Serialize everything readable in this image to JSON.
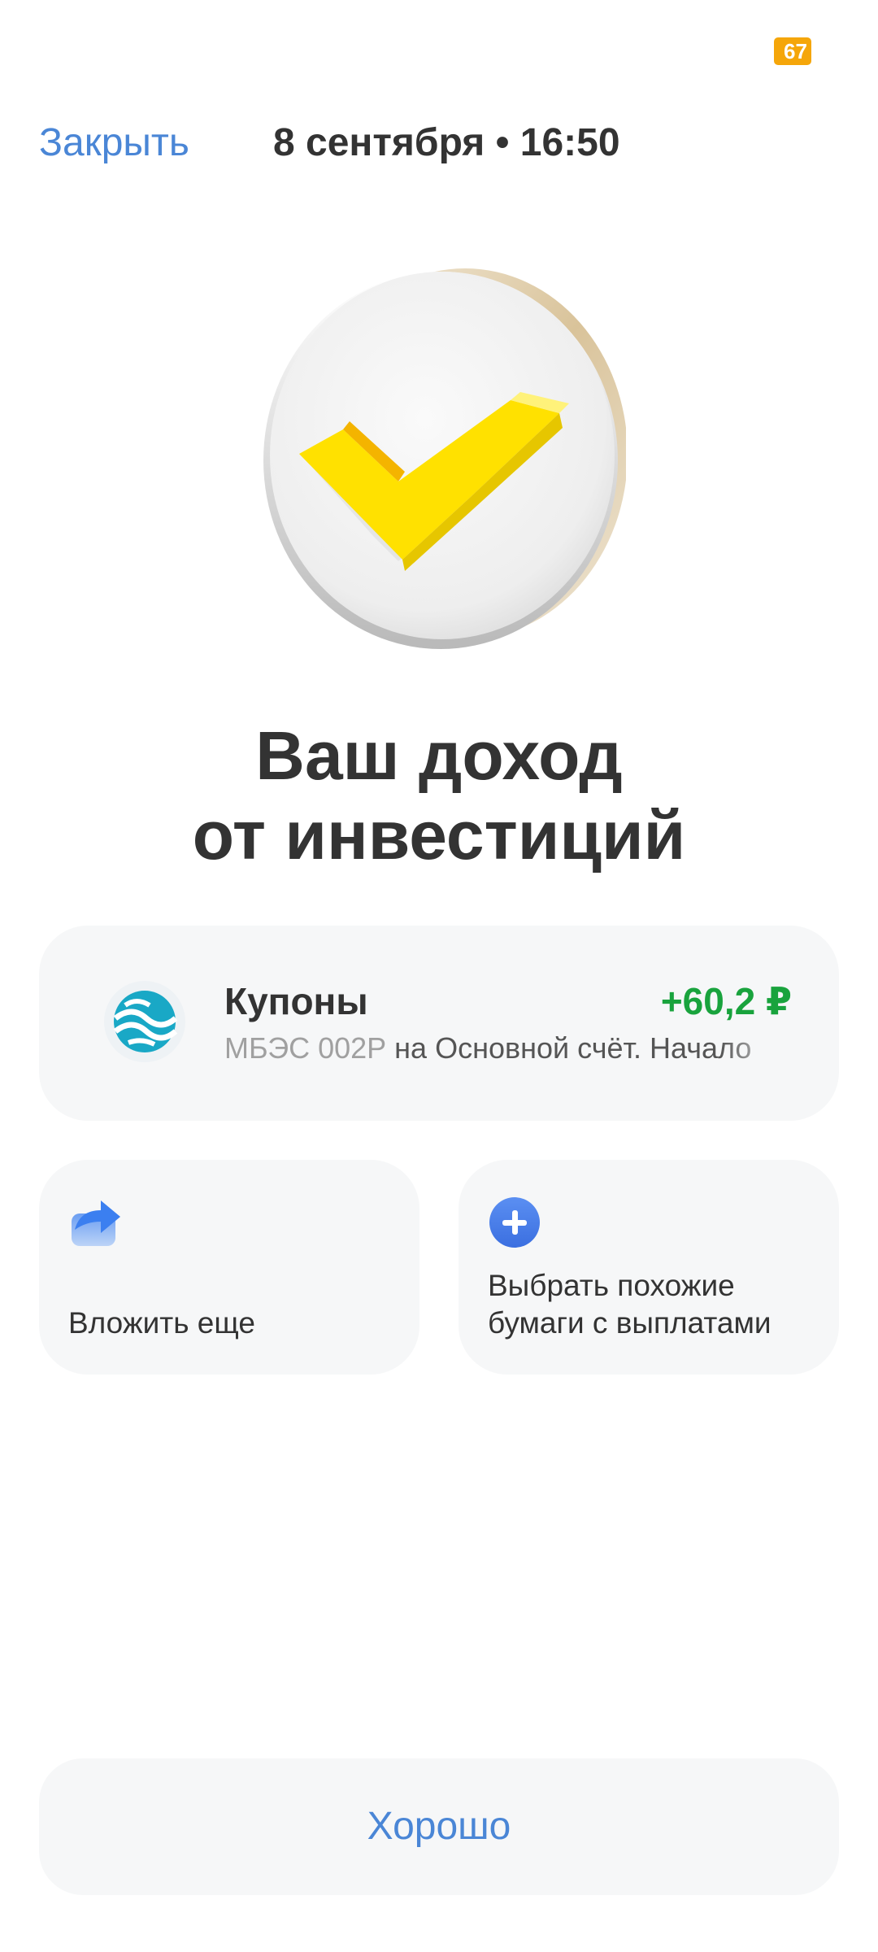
{
  "status_bar": {
    "battery_level": "67"
  },
  "header": {
    "close_label": "Закрыть",
    "date_time": "8 сентября • 16:50"
  },
  "hero": {
    "icon": "checkmark-coin-icon",
    "title_line1": "Ваш доход",
    "title_line2": "от инвестиций"
  },
  "coupon": {
    "issuer_icon": "issuer-logo-icon",
    "title": "Купоны",
    "amount": "+60,2 ₽",
    "description_prefix": "МБЭС 002Р",
    "description_rest": " на Основной счёт. Начало"
  },
  "actions": [
    {
      "label": "Вложить еще",
      "icon": "share-arrow-icon"
    },
    {
      "label": "Выбрать похожие бумаги с выплатами",
      "icon": "plus-circle-icon"
    }
  ],
  "footer": {
    "ok_label": "Хорошо"
  },
  "colors": {
    "accent_blue": "#4a86d6",
    "income_green": "#19a33d",
    "check_yellow": "#ffe100",
    "card_bg": "#f6f7f8",
    "battery_orange": "#f5a60a"
  }
}
